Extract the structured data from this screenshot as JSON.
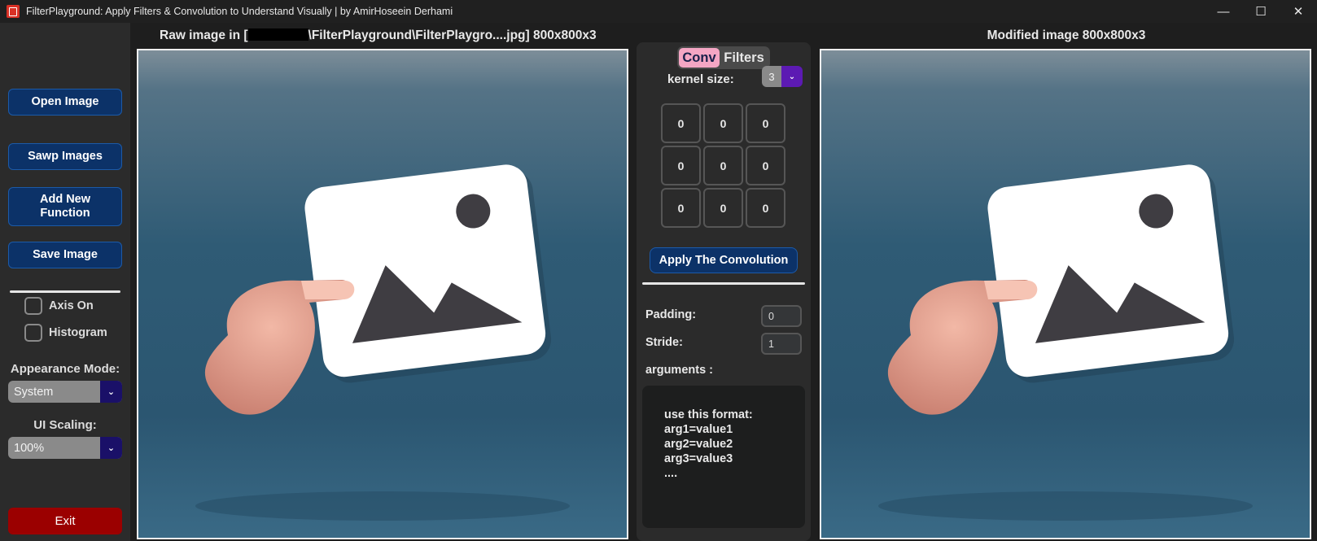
{
  "window": {
    "title": "FilterPlayground: Apply Filters & Convolution to Understand Visually | by AmirHoseein Derhami",
    "minimize": "—",
    "maximize": "☐",
    "close": "✕"
  },
  "sidebar": {
    "open_image": "Open Image",
    "swap_images": "Sawp Images",
    "add_function": "Add New Function",
    "save_image": "Save Image",
    "axis_on": "Axis On",
    "histogram": "Histogram",
    "appearance_label": "Appearance Mode:",
    "appearance_value": "System",
    "scaling_label": "UI Scaling:",
    "scaling_value": "100%",
    "exit": "Exit"
  },
  "raw_image": {
    "title_prefix": "Raw image in [",
    "title_suffix": "\\FilterPlayground\\FilterPlaygro....jpg] 800x800x3"
  },
  "modified_image": {
    "title": "Modified image 800x800x3"
  },
  "center": {
    "tabs": [
      "Conv",
      "Filters"
    ],
    "active_tab": "Conv",
    "kernel_size_label": "kernel size:",
    "kernel_size_value": "3",
    "kernel": [
      "0",
      "0",
      "0",
      "0",
      "0",
      "0",
      "0",
      "0",
      "0"
    ],
    "apply_button": "Apply The Convolution",
    "padding_label": "Padding:",
    "padding_value": "0",
    "stride_label": "Stride:",
    "stride_value": "1",
    "arguments_label": "arguments :",
    "arguments_help": [
      "use this format:",
      "arg1=value1",
      "arg2=value2",
      "arg3=value3",
      "...."
    ]
  },
  "colors": {
    "button": "#0c3268",
    "exit": "#9b0000",
    "tab_active": "#f4a6c4",
    "dropdown_arrow": "#1a1068",
    "kernel_arrow": "#5c1ab3",
    "image_bg": "#2e5a74"
  },
  "icons": {
    "app": "app-logo-icon",
    "dropdown": "chevron-down-icon",
    "image": "picture-card-icon"
  }
}
